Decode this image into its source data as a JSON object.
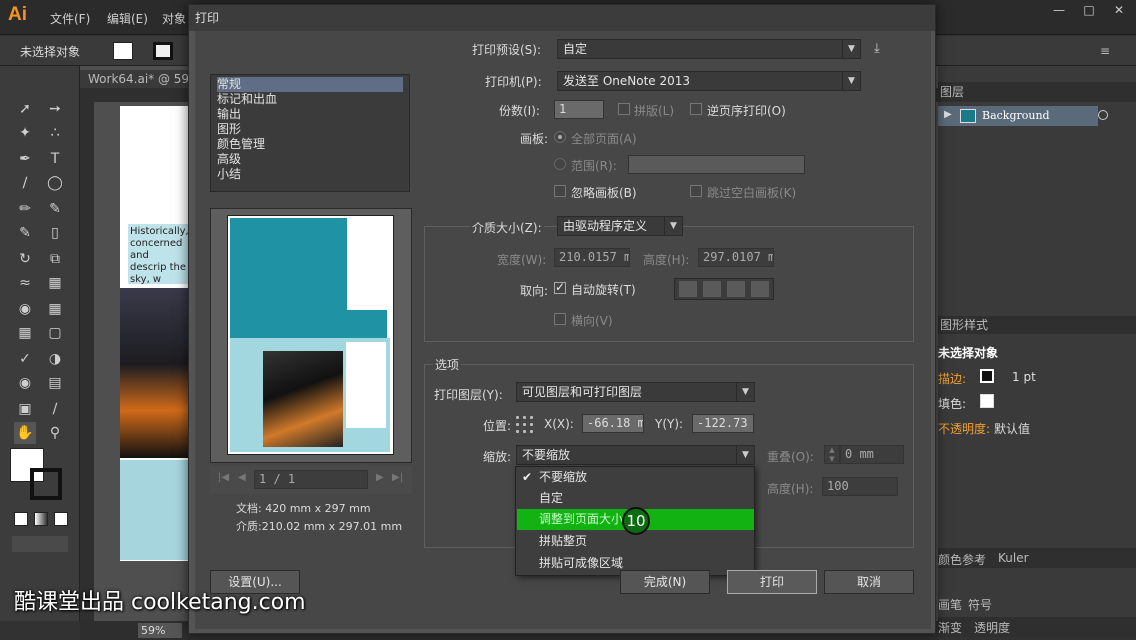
{
  "app": {
    "logo": "Ai",
    "menus": [
      "文件(F)",
      "编辑(E)",
      "对象"
    ],
    "control_bar_label": "未选择对象",
    "doc_tab": "Work64.ai* @ 59",
    "zoom": "59%",
    "artboard_text": "Historically, concerned and descrip the sky, w"
  },
  "right_panel": {
    "layers_tab": "图层",
    "layer_name": "Background",
    "graphic_styles_tab": "图形样式",
    "appearance_title": "未选择对象",
    "stroke_label": "描边:",
    "stroke_value": "1 pt",
    "fill_label": "填色:",
    "opacity_label": "不透明度:",
    "opacity_value": "默认值",
    "tabs_row1": [
      "颜色参考",
      "Kuler"
    ],
    "tabs_row2": [
      "画笔",
      "符号"
    ],
    "tabs_row3": [
      "渐变",
      "透明度"
    ]
  },
  "dialog": {
    "title": "打印",
    "nav_items": [
      "常规",
      "标记和出血",
      "输出",
      "图形",
      "颜色管理",
      "高级",
      "小结"
    ],
    "preset_label": "打印预设(S):",
    "preset_value": "自定",
    "printer_label": "打印机(P):",
    "printer_value": "发送至 OneNote 2013",
    "copies_label": "份数(I):",
    "copies_value": "1",
    "collate_label": "拼版(L)",
    "reverse_label": "逆页序打印(O)",
    "artboards_label": "画板:",
    "all_pages_label": "全部页面(A)",
    "range_label": "范围(R):",
    "ignore_artboards_label": "忽略画板(B)",
    "skip_blank_label": "跳过空白画板(K)",
    "media_size_label": "介质大小(Z):",
    "media_size_value": "由驱动程序定义",
    "width_label": "宽度(W):",
    "width_value": "210.0157 m",
    "height_label": "高度(H):",
    "height_value": "297.0107 m",
    "orientation_label": "取向:",
    "auto_rotate_label": "自动旋转(T)",
    "transverse_label": "横向(V)",
    "options_title": "选项",
    "print_layers_label": "打印图层(Y):",
    "print_layers_value": "可见图层和可打印图层",
    "position_label": "位置:",
    "x_label": "X(X):",
    "x_value": "-66.18 m",
    "y_label": "Y(Y):",
    "y_value": "-122.73",
    "scale_label": "缩放:",
    "scale_value": "不要缩放",
    "overlap_label": "重叠(O):",
    "overlap_value": "0 mm",
    "scale_height_label": "高度(H):",
    "scale_height_value": "100",
    "page_indicator": "1 / 1",
    "doc_size": "文档: 420 mm x 297 mm",
    "media_size_info": "介质:210.02 mm x 297.01 mm",
    "setup_button": "设置(U)...",
    "done_button": "完成(N)",
    "print_button": "打印",
    "cancel_button": "取消",
    "scale_options": [
      "不要缩放",
      "自定",
      "调整到页面大小",
      "拼贴整页",
      "拼贴可成像区域"
    ],
    "scale_checked_index": 0,
    "scale_highlighted_index": 2
  },
  "overlay": {
    "step_number": "10",
    "watermark": "酷课堂出品 coolketang.com"
  },
  "colors": {
    "accent_highlight": "#12b212",
    "selected_nav": "#5f6e86",
    "ai_orange": "#f7931e"
  }
}
